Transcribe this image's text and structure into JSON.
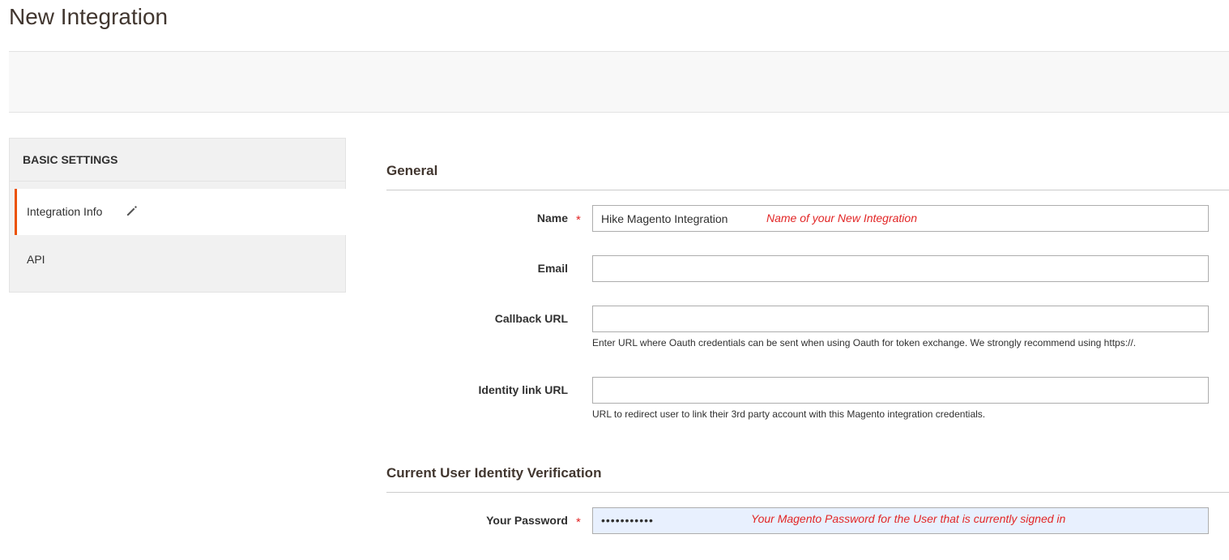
{
  "page": {
    "title": "New Integration"
  },
  "sidebar": {
    "heading": "BASIC SETTINGS",
    "tabs": [
      {
        "label": "Integration Info",
        "active": true
      },
      {
        "label": "API",
        "active": false
      }
    ]
  },
  "general": {
    "title": "General",
    "name": {
      "label": "Name",
      "required_mark": "*",
      "value": "Hike Magento Integration",
      "annotation": "Name of your New Integration"
    },
    "email": {
      "label": "Email",
      "value": ""
    },
    "callback": {
      "label": "Callback URL",
      "value": "",
      "note": "Enter URL where Oauth credentials can be sent when using Oauth for token exchange. We strongly recommend using https://."
    },
    "identity": {
      "label": "Identity link URL",
      "value": "",
      "note": "URL to redirect user to link their 3rd party account with this Magento integration credentials."
    }
  },
  "verification": {
    "title": "Current User Identity Verification",
    "password": {
      "label": "Your Password",
      "required_mark": "*",
      "value": "•••••••••••",
      "annotation": "Your Magento Password for the User that is currently signed in"
    }
  },
  "colors": {
    "accent": "#eb5202",
    "required": "#e22626",
    "autofill": "#e8f0fe"
  },
  "icons": {
    "edit": "pencil-icon"
  }
}
